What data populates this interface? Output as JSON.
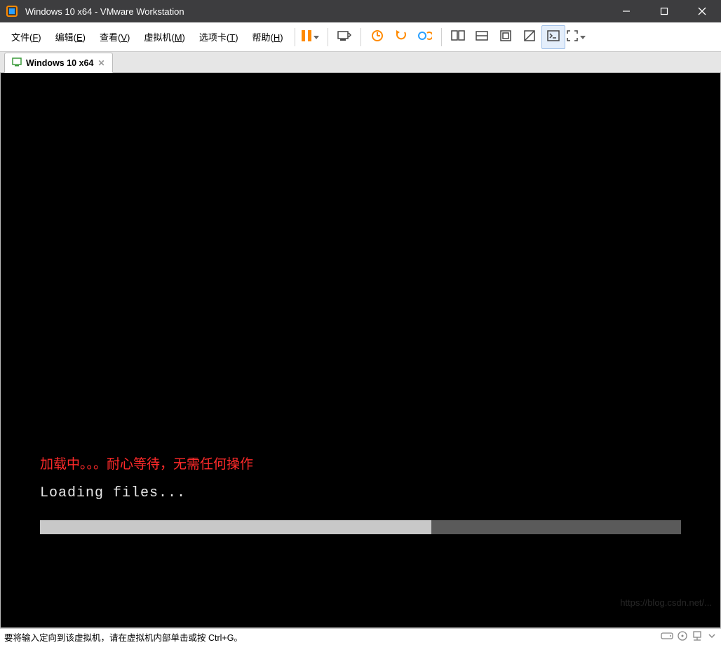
{
  "window": {
    "title": "Windows 10 x64 - VMware Workstation"
  },
  "menu": {
    "file": {
      "label": "文件(",
      "key": "F",
      "tail": ")"
    },
    "edit": {
      "label": "编辑(",
      "key": "E",
      "tail": ")"
    },
    "view": {
      "label": "查看(",
      "key": "V",
      "tail": ")"
    },
    "vm": {
      "label": "虚拟机(",
      "key": "M",
      "tail": ")"
    },
    "tabs": {
      "label": "选项卡(",
      "key": "T",
      "tail": ")"
    },
    "help": {
      "label": "帮助(",
      "key": "H",
      "tail": ")"
    }
  },
  "toolbar": {
    "icons": {
      "pause": "pause-icon",
      "install_tools": "install-tools-icon",
      "snapshot_take": "snapshot-take-icon",
      "snapshot_revert": "snapshot-revert-icon",
      "snapshot_manager": "snapshot-manager-icon",
      "multimon1": "multimon-left-icon",
      "multimon2": "multimon-single-icon",
      "unity": "unity-icon",
      "disable_input": "disable-input-icon",
      "console": "console-icon",
      "fullscreen": "fullscreen-icon"
    }
  },
  "tab": {
    "label": "Windows 10 x64"
  },
  "vm": {
    "red_note": "加载中。。。耐心等待，无需任何操作",
    "loading_text": "Loading files...",
    "progress_percent": 61
  },
  "status": {
    "hint": "要将输入定向到该虚拟机，请在虚拟机内部单击或按 Ctrl+G。"
  },
  "watermark": "https://blog.csdn.net/..."
}
